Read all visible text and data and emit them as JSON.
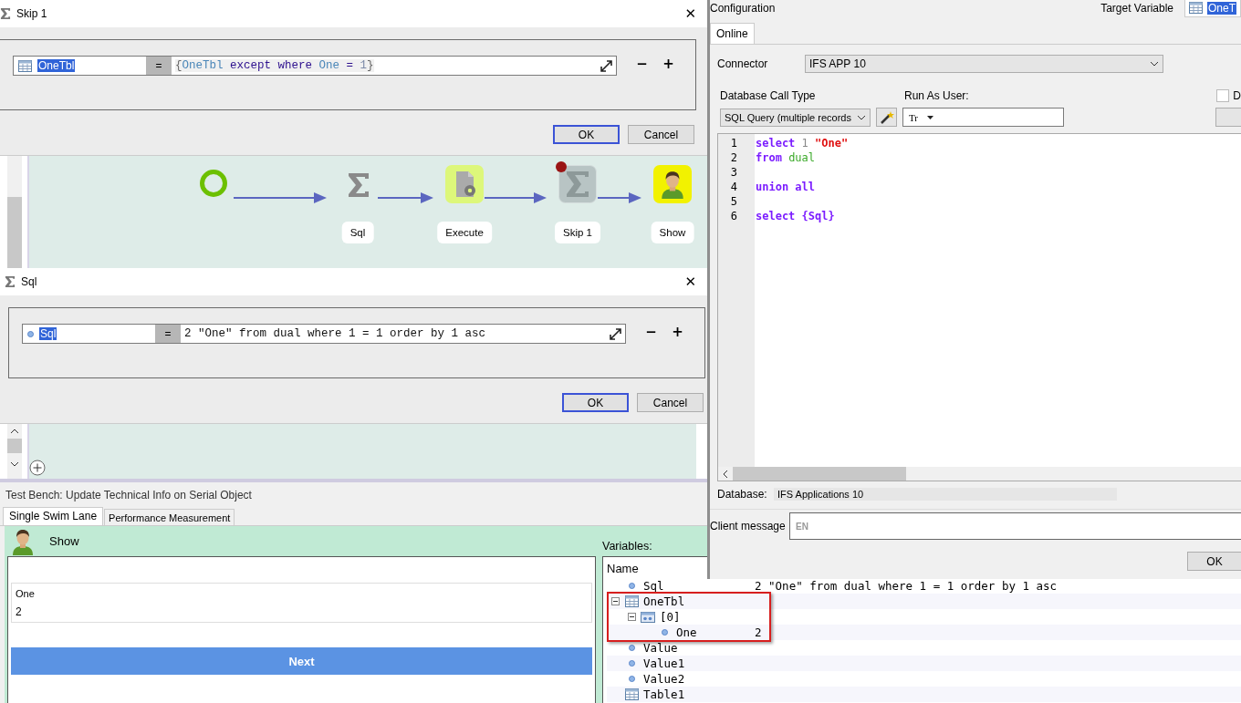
{
  "skip_dialog": {
    "title": "Skip 1",
    "close": "✕",
    "target": "OneTbl",
    "operator": "=",
    "expression": [
      {
        "text": "{",
        "kind": "plain"
      },
      {
        "text": "OneTbl",
        "kind": "variable"
      },
      {
        "text": " except where ",
        "kind": "keyword"
      },
      {
        "text": "One",
        "kind": "variable"
      },
      {
        "text": " = ",
        "kind": "keyword"
      },
      {
        "text": "1",
        "kind": "number"
      },
      {
        "text": "}",
        "kind": "plain"
      }
    ],
    "minus": "−",
    "plus": "+",
    "buttons": [
      {
        "label": "OK",
        "selected": true
      },
      {
        "label": "Cancel",
        "selected": false
      }
    ]
  },
  "flow": {
    "nodes": [
      {
        "kind": "start",
        "breakpoint": false
      },
      {
        "kind": "sigma",
        "label": "Sql",
        "breakpoint": false
      },
      {
        "kind": "execute",
        "label": "Execute",
        "breakpoint": false
      },
      {
        "kind": "skipped",
        "label": "Skip 1",
        "breakpoint": true
      },
      {
        "kind": "person",
        "label": "Show",
        "breakpoint": false
      }
    ]
  },
  "sql_dialog": {
    "title": "Sql",
    "close": "✕",
    "target": "Sql",
    "operator": "=",
    "expression": [
      {
        "text": "2 \"One\" from dual where 1 = 1 order by 1 asc",
        "kind": "text"
      }
    ],
    "minus": "−",
    "plus": "+",
    "buttons": [
      {
        "label": "OK",
        "selected": true
      },
      {
        "label": "Cancel",
        "selected": false
      }
    ]
  },
  "configuration": {
    "title": "Configuration",
    "target_label": "Target Variable",
    "target_value": "OneT",
    "tabs": [
      {
        "label": "Online",
        "selected": true
      }
    ],
    "connector_label": "Connector",
    "connector_value": "IFS APP 10",
    "call_type_label": "Database Call Type",
    "call_type_value": "SQL Query (multiple records",
    "run_as_label": "Run As User:",
    "run_as_type": "Tr",
    "checkbox": {
      "label": "D",
      "checked": false
    },
    "code": [
      {
        "number": "1",
        "tokens": [
          {
            "text": "select",
            "kind": "keyword"
          },
          {
            "text": " 1 ",
            "kind": "number"
          },
          {
            "text": "\"One\"",
            "kind": "string"
          }
        ]
      },
      {
        "number": "2",
        "tokens": [
          {
            "text": "from",
            "kind": "keyword"
          },
          {
            "text": " dual",
            "kind": "identifier"
          }
        ]
      },
      {
        "number": "3"
      },
      {
        "number": "4",
        "tokens": [
          {
            "text": "union all",
            "kind": "keyword"
          }
        ]
      },
      {
        "number": "5"
      },
      {
        "number": "6",
        "tokens": [
          {
            "text": "select",
            "kind": "keyword"
          },
          {
            "text": " {Sql}",
            "kind": "variable"
          }
        ]
      }
    ],
    "database_label": "Database:",
    "database_value": "IFS Applications 10",
    "client_message_label": "Client message",
    "client_message_language": "EN",
    "ok": "OK"
  },
  "test_bench": {
    "title": "Test Bench: Update Technical Info on Serial Object",
    "tabs": [
      {
        "label": "Single Swim Lane",
        "selected": true
      },
      {
        "label": "Performance Measurement",
        "selected": false
      }
    ],
    "lane_title": "Show",
    "field": {
      "label": "One",
      "value": "2"
    },
    "next": "Next",
    "variables_label": "Variables:",
    "column": "Name",
    "variables": [
      {
        "name": "Sql",
        "kind": "value",
        "value": "2 \"One\" from dual where 1 = 1 order by 1 asc",
        "highlighted": false
      },
      {
        "name": "OneTbl",
        "kind": "table",
        "expanded": true,
        "highlighted": true,
        "children": [
          {
            "name": "[0]",
            "kind": "record",
            "expanded": true,
            "highlighted": false,
            "children": [
              {
                "name": "One",
                "kind": "value",
                "value": "2",
                "highlighted": false
              }
            ]
          }
        ]
      },
      {
        "name": "Value",
        "kind": "value",
        "highlighted": false
      },
      {
        "name": "Value1",
        "kind": "value",
        "highlighted": false
      },
      {
        "name": "Value2",
        "kind": "value",
        "highlighted": false
      },
      {
        "name": "Table1",
        "kind": "table",
        "highlighted": false
      }
    ]
  }
}
